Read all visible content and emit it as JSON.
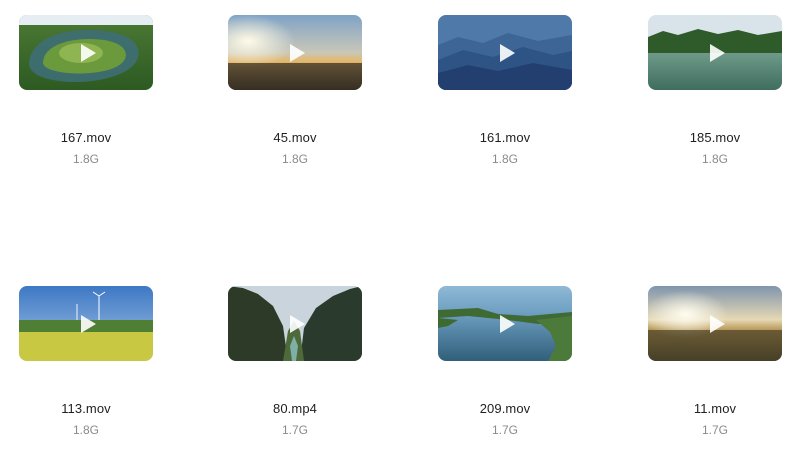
{
  "files": [
    {
      "name": "167.mov",
      "size": "1.8G"
    },
    {
      "name": "45.mov",
      "size": "1.8G"
    },
    {
      "name": "161.mov",
      "size": "1.8G"
    },
    {
      "name": "185.mov",
      "size": "1.8G"
    },
    {
      "name": "113.mov",
      "size": "1.8G"
    },
    {
      "name": "80.mp4",
      "size": "1.7G"
    },
    {
      "name": "209.mov",
      "size": "1.7G"
    },
    {
      "name": "11.mov",
      "size": "1.7G"
    }
  ],
  "icons": {
    "play": "play-icon"
  },
  "colors": {
    "name_text": "#1f1f1f",
    "size_text": "#8a8a8a",
    "play_icon": "#ffffff"
  }
}
